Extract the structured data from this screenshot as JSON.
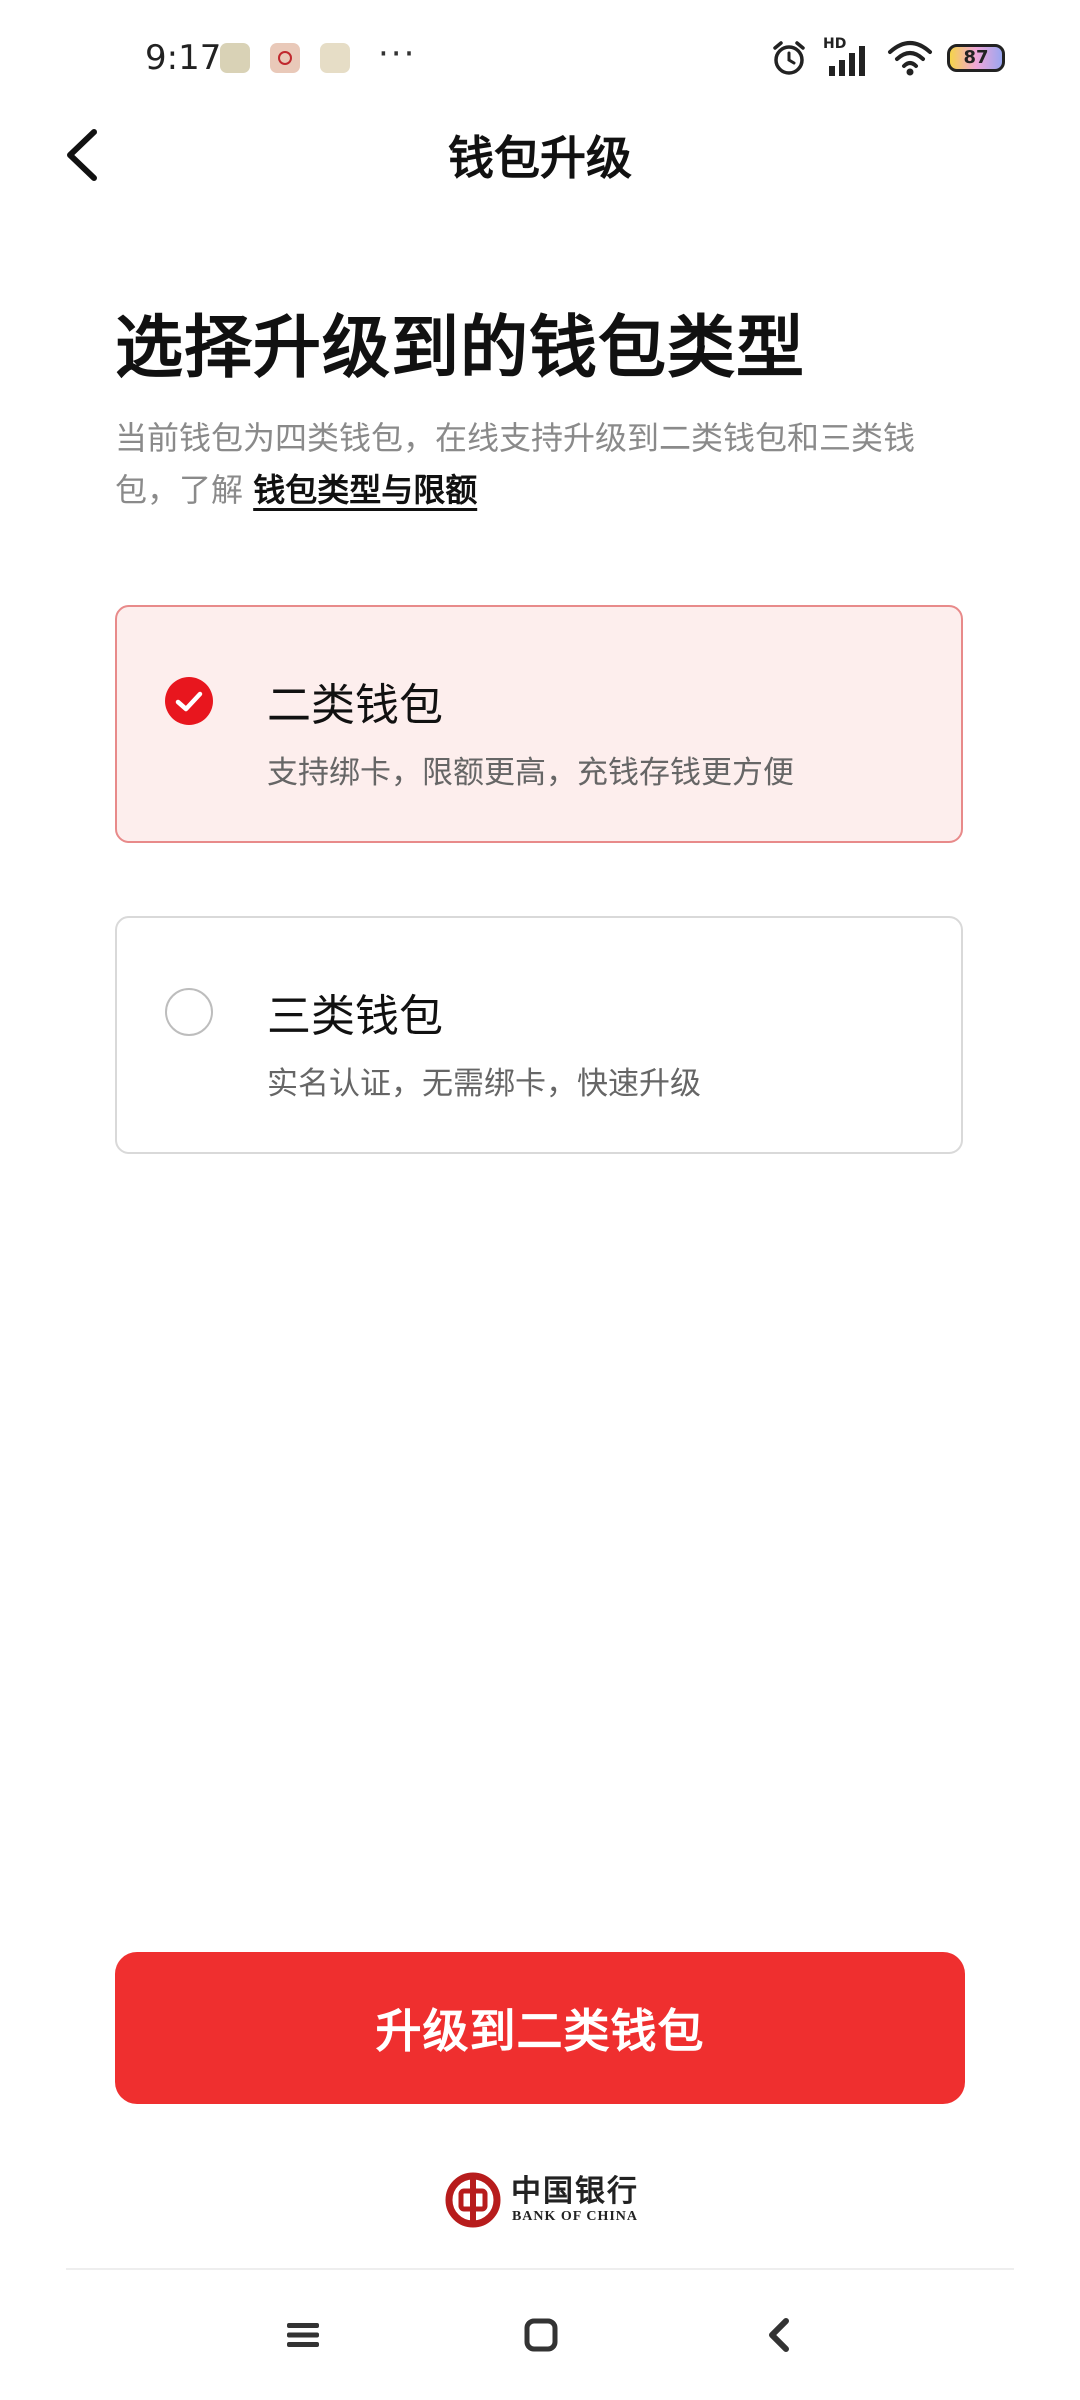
{
  "status_bar": {
    "time": "9:17",
    "dots": "···",
    "signal_label": "HD",
    "battery": "87",
    "icons": [
      "alarm-icon",
      "cell-signal-icon",
      "wifi-icon",
      "battery-icon"
    ]
  },
  "header": {
    "title": "钱包升级",
    "back_icon": "chevron-left-icon"
  },
  "main": {
    "heading": "选择升级到的钱包类型",
    "intro_text": "当前钱包为四类钱包，在线支持升级到二类钱包和三类钱包，了解 ",
    "intro_link": "钱包类型与限额"
  },
  "options": [
    {
      "title": "二类钱包",
      "desc": "支持绑卡，限额更高，充钱存钱更方便",
      "selected": true
    },
    {
      "title": "三类钱包",
      "desc": "实名认证，无需绑卡，快速升级",
      "selected": false
    }
  ],
  "primary_button": {
    "label": "升级到二类钱包"
  },
  "footer": {
    "bank_name_cn": "中国银行",
    "bank_name_en": "BANK OF CHINA"
  },
  "colors": {
    "accent": "#ef2f2f",
    "check": "#e8161e",
    "selected_bg": "#fdeeed",
    "selected_border": "#e88a8a",
    "muted_text": "#8a8a8a"
  }
}
